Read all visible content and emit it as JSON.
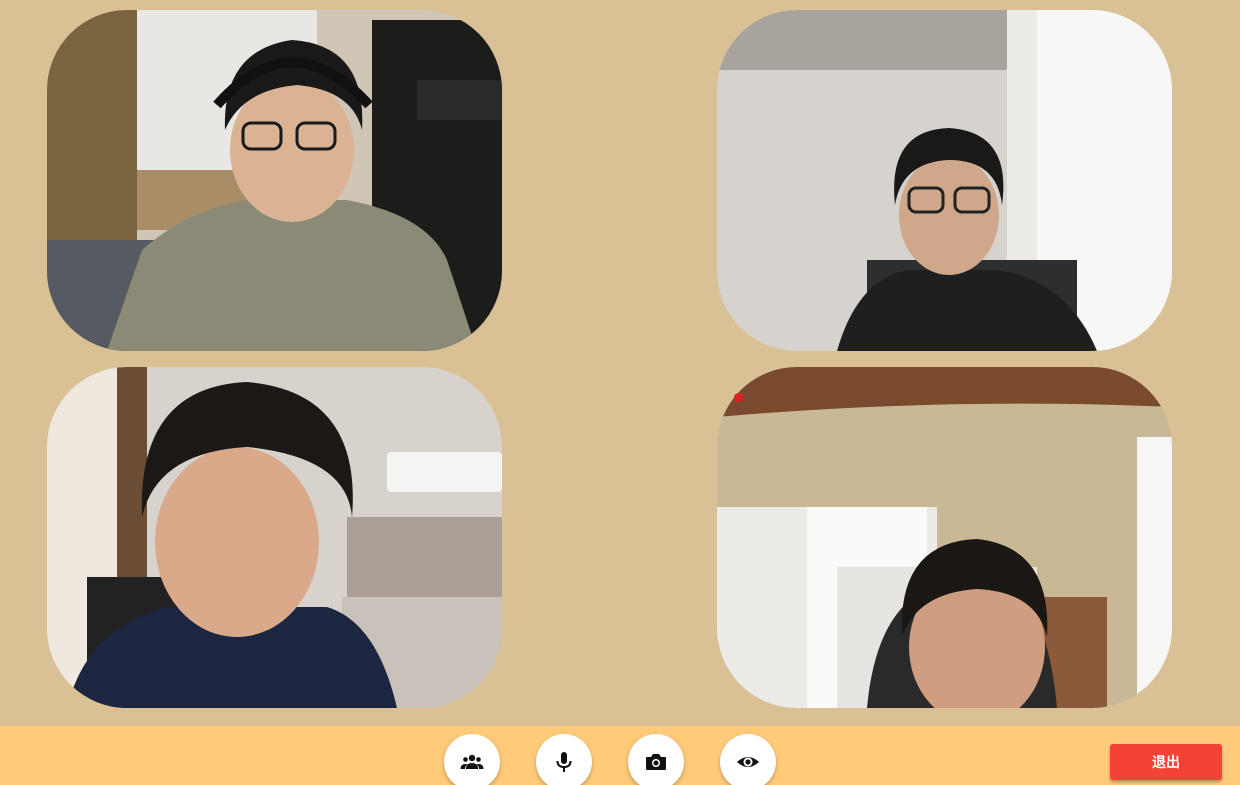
{
  "participants": [
    {
      "id": "p1",
      "description_icon": "video-feed"
    },
    {
      "id": "p2",
      "description_icon": "video-feed"
    },
    {
      "id": "p3",
      "description_icon": "video-feed"
    },
    {
      "id": "p4",
      "description_icon": "video-feed"
    }
  ],
  "toolbar": {
    "buttons": [
      {
        "icon": "people-icon"
      },
      {
        "icon": "microphone-icon"
      },
      {
        "icon": "camera-icon"
      },
      {
        "icon": "eye-icon"
      }
    ],
    "exit_label": "退出"
  },
  "colors": {
    "background": "#d9c095",
    "toolbar": "#ffca7a",
    "exit_button": "#f44336",
    "recording_dot": "#e02020"
  }
}
